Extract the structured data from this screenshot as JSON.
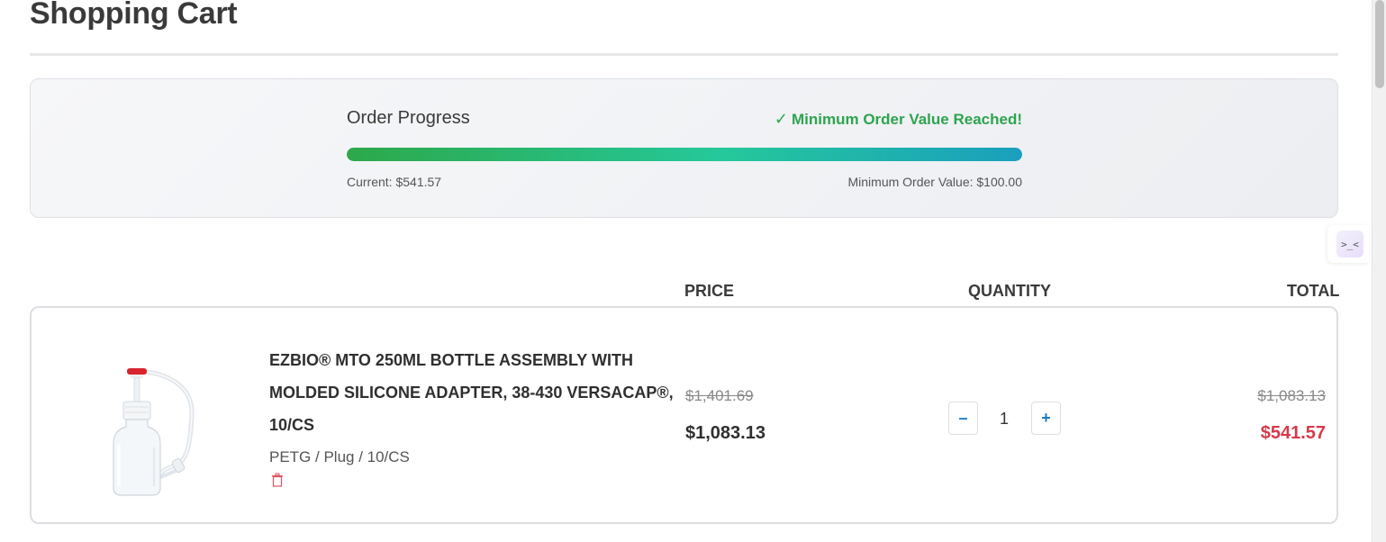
{
  "page": {
    "title": "Shopping Cart"
  },
  "order_progress": {
    "heading": "Order Progress",
    "status_icon": "check-icon",
    "status_text": "Minimum Order Value Reached!",
    "current_label": "Current: $541.57",
    "minimum_label": "Minimum Order Value: $100.00",
    "progress_fraction": 1.0,
    "colors": {
      "status": "#2ea44f",
      "fill_start": "#2da84a",
      "fill_mid": "#25c89a",
      "fill_end": "#1a9fbe"
    }
  },
  "table_headers": {
    "price": "PRICE",
    "quantity": "QUANTITY",
    "total": "TOTAL"
  },
  "cart_items": [
    {
      "name": "EZBIO® MTO 250ML BOTTLE ASSEMBLY WITH MOLDED SILICONE ADAPTER, 38-430 VERSACAP®, 10/CS",
      "variant": "PETG / Plug / 10/CS",
      "price_original": "$1,401.69",
      "price_current": "$1,083.13",
      "quantity": "1",
      "decrement_label": "–",
      "increment_label": "+",
      "total_original": "$1,083.13",
      "total_current": "$541.57"
    }
  ],
  "side_widget": {
    "label": ">_<"
  }
}
